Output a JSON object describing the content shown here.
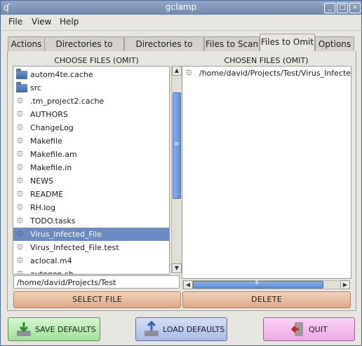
{
  "window": {
    "title": "gclamp",
    "buttons": [
      "minimize",
      "maximize",
      "close"
    ]
  },
  "menu": [
    "File",
    "View",
    "Help"
  ],
  "tabs": [
    "Actions",
    "Directories to Scan",
    "Directories to Omit",
    "Files to Scan",
    "Files to Omit",
    "Options"
  ],
  "active_tab": "Files to Omit",
  "left": {
    "header": "CHOOSE FILES (OMIT)",
    "items": [
      {
        "label": "autom4te.cache",
        "type": "folder"
      },
      {
        "label": "src",
        "type": "folder"
      },
      {
        "label": ".tm_project2.cache",
        "type": "file"
      },
      {
        "label": "AUTHORS",
        "type": "file"
      },
      {
        "label": "ChangeLog",
        "type": "file"
      },
      {
        "label": "Makefile",
        "type": "file"
      },
      {
        "label": "Makefile.am",
        "type": "file"
      },
      {
        "label": "Makefile.in",
        "type": "file"
      },
      {
        "label": "NEWS",
        "type": "file"
      },
      {
        "label": "README",
        "type": "file"
      },
      {
        "label": "RH.log",
        "type": "file"
      },
      {
        "label": "TODO.tasks",
        "type": "file"
      },
      {
        "label": "Virus_Infected_File",
        "type": "file",
        "selected": true
      },
      {
        "label": "Virus_Infected_File.test",
        "type": "file"
      },
      {
        "label": "aclocal.m4",
        "type": "file"
      },
      {
        "label": "autogen.sh",
        "type": "file"
      }
    ],
    "path": "/home/david/Projects/Test",
    "button": "SELECT FILE"
  },
  "right": {
    "header": "CHOSEN FILES (OMIT)",
    "items": [
      {
        "label": "/home/david/Projects/Test/Virus_Infecte"
      }
    ],
    "button": "DELETE"
  },
  "bottom": {
    "save": "SAVE DEFAULTS",
    "load": "LOAD DEFAULTS",
    "quit": "QUIT"
  },
  "colors": {
    "selection": "#6b8bc4",
    "save_bg": "#b6f0b0",
    "load_bg": "#b8c8ee",
    "quit_bg": "#f6b8f0",
    "action_button": "#e8b89a"
  }
}
